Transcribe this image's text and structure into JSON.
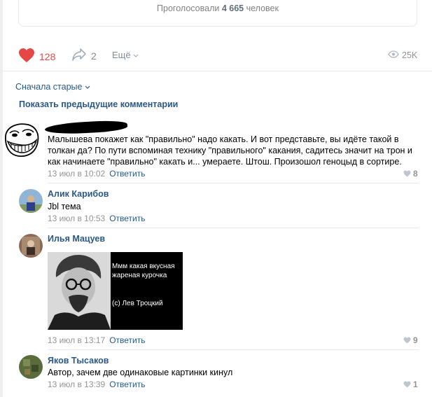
{
  "poll": {
    "prefix": "Проголосовали ",
    "count": "4 665",
    "suffix": " человек"
  },
  "actions": {
    "likes": "128",
    "shares": "2",
    "more_label": "Ещё",
    "views": "25K"
  },
  "comments_header": {
    "sort_label": "Сначала старые",
    "show_previous": "Показать предыдущие комментарии"
  },
  "comments": [
    {
      "author": "",
      "text": "Малышева покажет как \"правильно\" надо какать. И вот представьте, вы идёте такой в толкан да? По пути вспоминая технику \"правильного\" какания, садитесь значит на трон и как начинаете \"правильно\" какать и... умераете. Штош. Произошол геноцыд в сортире.",
      "date": "13 июл в 10:02",
      "reply": "Ответить",
      "likes": "8"
    },
    {
      "author": "Алик Карибов",
      "text": "Jbl тема",
      "date": "13 июл в 10:53",
      "reply": "Ответить",
      "likes": ""
    },
    {
      "author": "Илья Мацуев",
      "image_caption": "Ммм какая вкусная жареная курочка",
      "image_signature": "(с) Лев Троцкий",
      "date": "13 июл в 13:17",
      "reply": "Ответить",
      "likes": "9"
    },
    {
      "author": "Яков Тысаков",
      "text": "Автор, зачем две одинаковые картинки кинул",
      "date": "13 июл в 13:39",
      "reply": "Ответить",
      "likes": "1"
    }
  ],
  "colors": {
    "link": "#2a5885",
    "like_active": "#e64646",
    "muted": "#939393",
    "divider": "#e7e8ec"
  },
  "icons": [
    "heart-icon",
    "share-icon",
    "chevron-down-icon",
    "eye-icon",
    "small-heart-icon"
  ]
}
